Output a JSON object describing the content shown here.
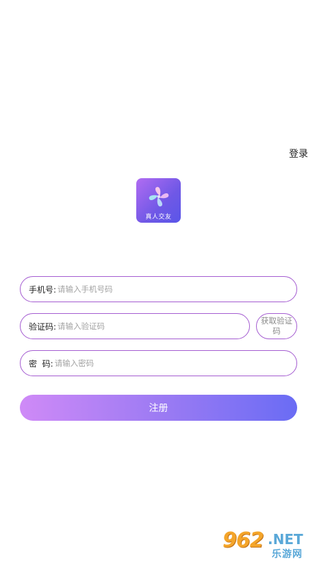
{
  "header": {
    "login_label": "登录"
  },
  "logo": {
    "app_name": "真人交友"
  },
  "form": {
    "phone": {
      "label": "手机号:",
      "placeholder": "请输入手机号码",
      "value": ""
    },
    "code": {
      "label": "验证码:",
      "placeholder": "请输入验证码",
      "value": ""
    },
    "get_code_label": "获取验证码",
    "password": {
      "label": "密  码:",
      "placeholder": "请输入密码",
      "value": ""
    },
    "register_label": "注册"
  },
  "watermark": {
    "number": "962",
    "suffix": ".NET",
    "site": "乐游网"
  },
  "colors": {
    "accent": "#a35ad0",
    "button_start": "#cf8af7",
    "button_end": "#6a6cf4"
  }
}
